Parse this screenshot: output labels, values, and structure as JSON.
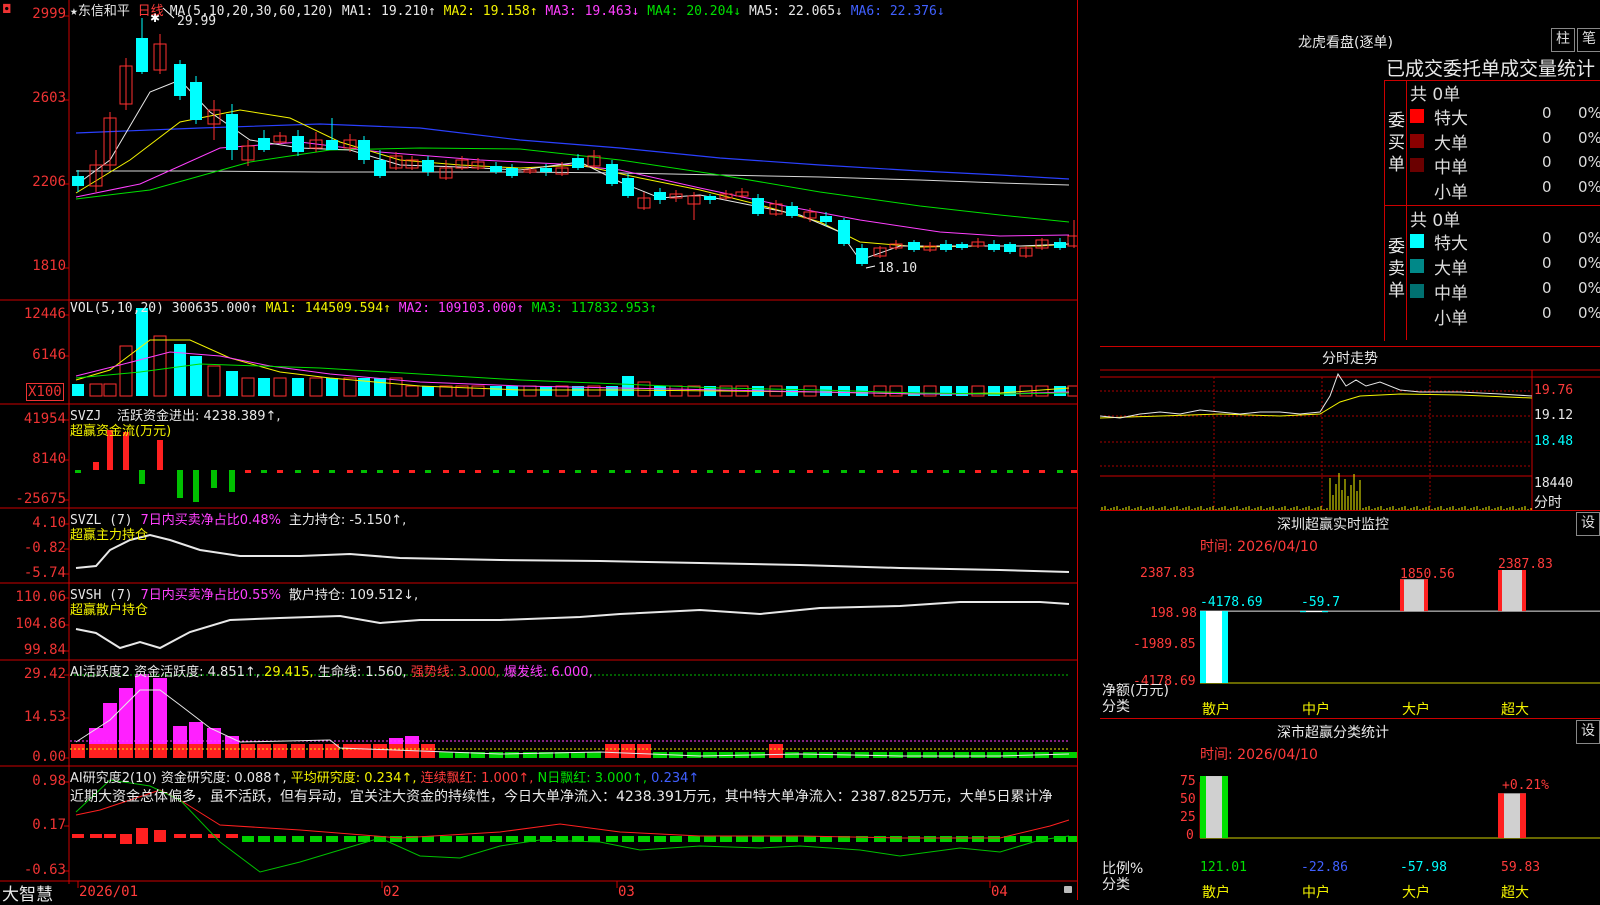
{
  "stock": {
    "name": "东信和平",
    "period": "日线",
    "star": "★",
    "flag": "◘"
  },
  "main_panel": {
    "ma_title": "MA(5,10,20,30,60,120)",
    "ma": [
      {
        "label": "MA1:",
        "value": "19.210↑",
        "color": "#e8e8e8"
      },
      {
        "label": "MA2:",
        "value": "19.158↑",
        "color": "#f3f300"
      },
      {
        "label": "MA3:",
        "value": "19.463↓",
        "color": "#ff40ff"
      },
      {
        "label": "MA4:",
        "value": "20.204↓",
        "color": "#00e000"
      },
      {
        "label": "MA5:",
        "value": "22.065↓",
        "color": "#e8e8e8"
      },
      {
        "label": "MA6:",
        "value": "22.376↓",
        "color": "#4060ff"
      }
    ],
    "y_labels": [
      "2999",
      "2603",
      "2206",
      "1810"
    ],
    "high_mark": "29.99",
    "low_mark": "18.10"
  },
  "vol_panel": {
    "title": "VOL(5,10,20)",
    "value": "300635.000↑",
    "ma1": "MA1: 144509.594↑",
    "ma2": "MA2: 109103.000↑",
    "ma3": "MA3: 117832.953↑",
    "y_labels": [
      "12446",
      "6146"
    ],
    "unit": "X100"
  },
  "svzj_panel": {
    "title": "SVZJ",
    "desc": "活跃资金进出: 4238.389↑,",
    "sub": "超赢资金流(万元)",
    "y_labels": [
      "41954",
      "8140",
      "-25675"
    ]
  },
  "svzl_panel": {
    "title": "SVZL (7)",
    "desc": "7日内买卖净占比0.48%",
    "value": "主力持仓: -5.150↑,",
    "sub": "超赢主力持仓",
    "y_labels": [
      "4.10",
      "-0.82",
      "-5.74"
    ]
  },
  "svsh_panel": {
    "title": "SVSH (7)",
    "desc": "7日内买卖净占比0.55%",
    "value": "散户持仓: 109.512↓,",
    "sub": "超赢散户持仓",
    "y_labels": [
      "110.06",
      "104.86",
      "99.84"
    ]
  },
  "ai1_panel": {
    "title": "AI活跃度2",
    "v1": "资金活跃度: 4.851↑,",
    "v2": "29.415,",
    "v3": "生命线: 1.560,",
    "v4": "强势线: 3.000,",
    "v5": "爆发线: 6.000,",
    "y_labels": [
      "29.42",
      "14.53",
      "0.00"
    ]
  },
  "ai2_panel": {
    "title": "AI研究度2(10)",
    "v1": "资金研究度: 0.088↑,",
    "v2": "平均研究度: 0.234↑,",
    "v3": "连续飘红: 1.000↑,",
    "v4": "N日飘红: 3.000↑,",
    "v5": "0.234↑",
    "text": "近期大资金总体偏多，虽不活跃，但有异动，宜关注大资金的持续性，今日大单净流入：4238.391万元，其中特大单净流入：2387.825万元，大单5日累计净",
    "y_labels": [
      "0.98",
      "0.17",
      "-0.63"
    ]
  },
  "bottom": {
    "brand": "大智慧",
    "x_labels": [
      "2026/01",
      "02",
      "03",
      "04"
    ]
  },
  "lhb": {
    "title": "龙虎看盘(逐单)",
    "btn1": "柱",
    "btn2": "笔",
    "subtitle": "已成交委托单成交量统计",
    "buy": {
      "side": "委买单",
      "total": "共 0单",
      "rows": [
        {
          "label": "特大",
          "count": "0",
          "pct": "0%",
          "color": "#ff0000"
        },
        {
          "label": "大单",
          "count": "0",
          "pct": "0%",
          "color": "#8a0000"
        },
        {
          "label": "中单",
          "count": "0",
          "pct": "0%",
          "color": "#6a0000"
        },
        {
          "label": "小单",
          "count": "0",
          "pct": "0%",
          "color": "#000000"
        }
      ]
    },
    "sell": {
      "side": "委卖单",
      "total": "共 0单",
      "rows": [
        {
          "label": "特大",
          "count": "0",
          "pct": "0%",
          "color": "#00ffff"
        },
        {
          "label": "大单",
          "count": "0",
          "pct": "0%",
          "color": "#008888"
        },
        {
          "label": "中单",
          "count": "0",
          "pct": "0%",
          "color": "#007070"
        },
        {
          "label": "小单",
          "count": "0",
          "pct": "0%",
          "color": "#000000"
        }
      ]
    }
  },
  "fenshi": {
    "title": "分时走势",
    "y_labels": [
      "19.76",
      "19.12",
      "18.48",
      "18440"
    ],
    "unit": "分时"
  },
  "monitor": {
    "title": "深圳超赢实时监控",
    "btn": "设",
    "time": "时间: 2026/04/10",
    "y_labels": [
      "2387.83",
      "198.98",
      "-1989.85",
      "-4178.69"
    ],
    "ylabel": "净额(万元)",
    "xlabel": "分类",
    "categories": [
      "散户",
      "中户",
      "大户",
      "超大"
    ],
    "values": [
      -4178.69,
      -59.7,
      1850.56,
      2387.83
    ],
    "value_labels": [
      "-4178.69",
      "-59.7",
      "1850.56",
      "2387.83"
    ]
  },
  "classstat": {
    "title": "深市超赢分类统计",
    "btn": "设",
    "time": "时间: 2026/04/10",
    "y_labels": [
      "75",
      "50",
      "25",
      "0"
    ],
    "ylabel": "比例%",
    "xlabel": "分类",
    "categories": [
      "散户",
      "中户",
      "大户",
      "超大"
    ],
    "values": [
      121.01,
      -22.86,
      -57.98,
      59.83
    ],
    "value_labels": [
      "121.01",
      "-22.86",
      "-57.98",
      "59.83"
    ],
    "annotation": "+0.21%"
  },
  "chart_data": [
    {
      "type": "bar",
      "title": "深圳超赢实时监控",
      "categories": [
        "散户",
        "中户",
        "大户",
        "超大"
      ],
      "values": [
        -4178.69,
        -59.7,
        1850.56,
        2387.83
      ],
      "ylabel": "净额(万元)",
      "xlabel": "分类",
      "ylim": [
        -4178.69,
        2387.83
      ]
    },
    {
      "type": "bar",
      "title": "深市超赢分类统计",
      "categories": [
        "散户",
        "中户",
        "大户",
        "超大"
      ],
      "values": [
        121.01,
        -22.86,
        -57.98,
        59.83
      ],
      "ylabel": "比例%",
      "xlabel": "分类",
      "ylim": [
        0,
        75
      ]
    }
  ]
}
